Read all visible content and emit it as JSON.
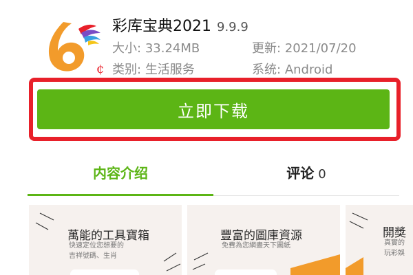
{
  "app": {
    "name": "彩库宝典2021",
    "version": "9.9.9",
    "icon": "app-logo-number-6"
  },
  "meta": {
    "size_label": "大小:",
    "size_value": "33.24MB",
    "update_label": "更新:",
    "update_value": "2021/07/20",
    "category_label": "类别:",
    "category_value": "生活服务",
    "system_label": "系统:",
    "system_value": "Android"
  },
  "download": {
    "label": "立即下载"
  },
  "tabs": {
    "intro": "内容介绍",
    "review": "评论",
    "review_count": "0"
  },
  "screenshots": [
    {
      "title": "萬能的工具寶箱",
      "line1": "快速定位您想要的",
      "line2": "吉祥號碼、生肖"
    },
    {
      "title": "豐富的圖庫資源",
      "line1": "免費為您網盡天下圖紙",
      "line2": ""
    },
    {
      "title": "開獎",
      "line1": "真實的",
      "line2": "玩彩娛"
    }
  ],
  "colors": {
    "accent_green": "#5cb515",
    "highlight_red": "#e8202a",
    "logo_orange": "#f29b2b"
  }
}
